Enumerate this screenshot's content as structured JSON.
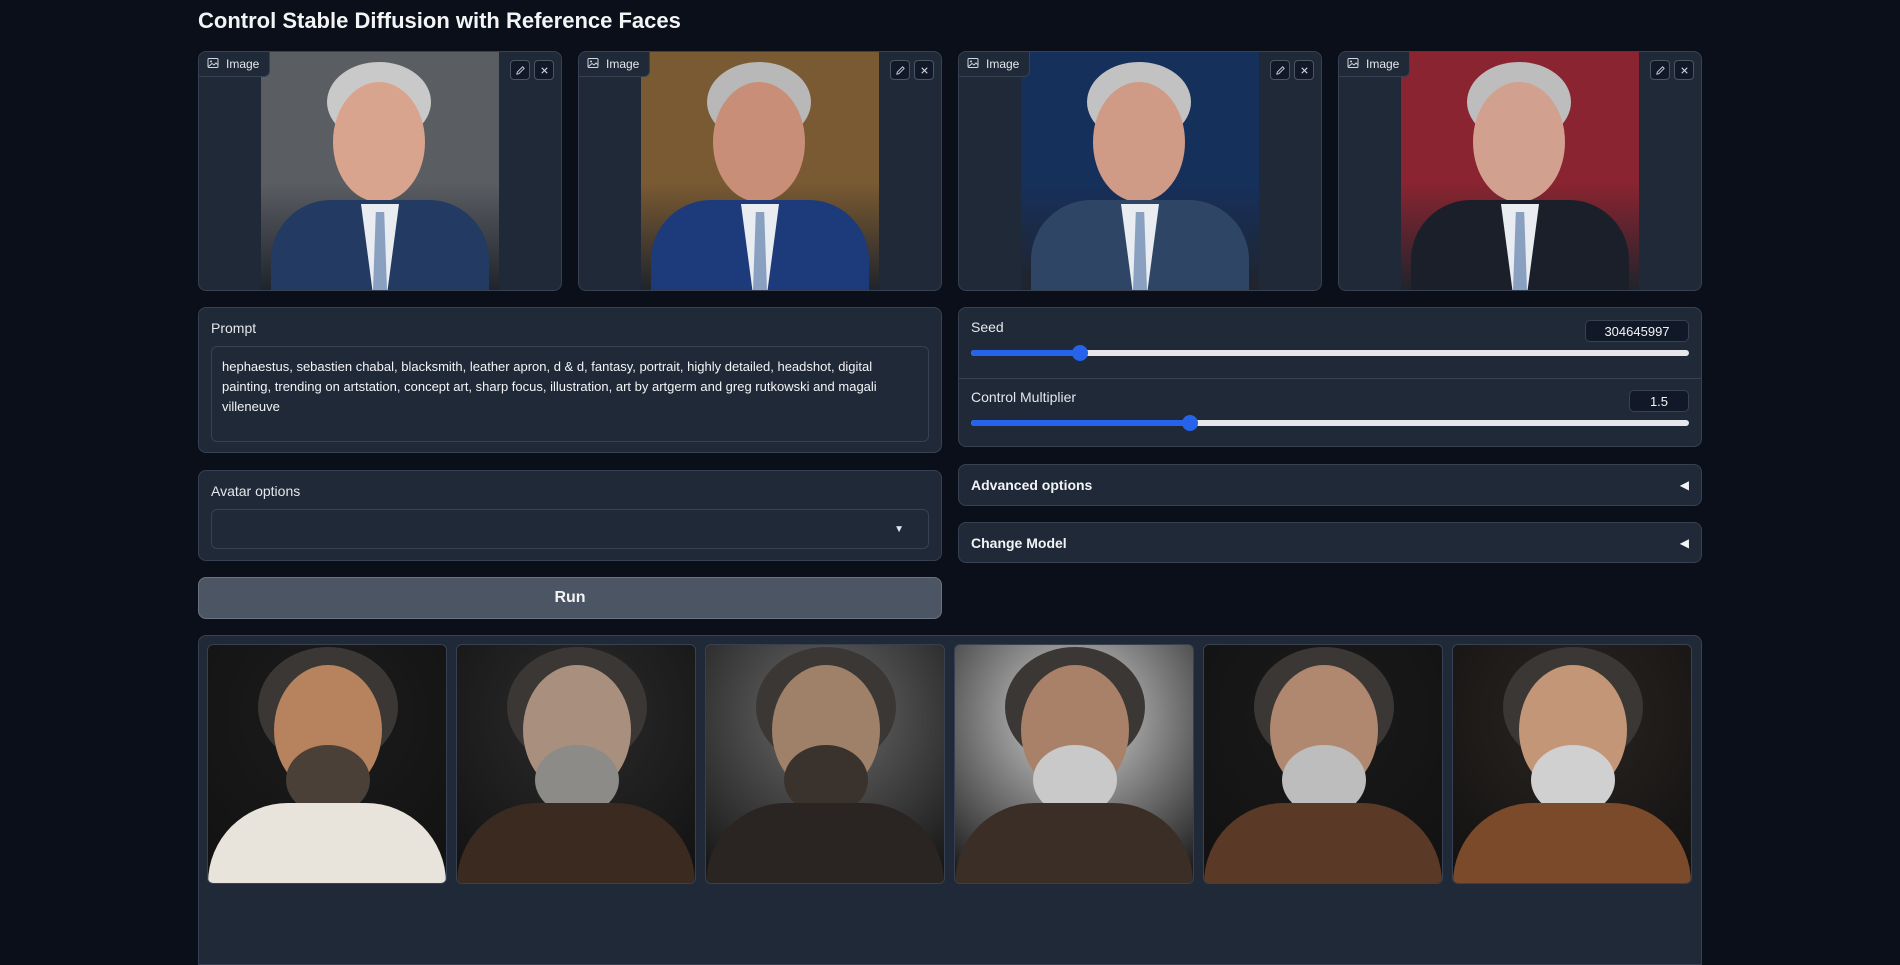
{
  "page": {
    "title": "Control Stable Diffusion with Reference Faces"
  },
  "reference_images": [
    {
      "label": "Image",
      "icon": "image-icon",
      "bg": "#5a5e63",
      "suit": "#233a63",
      "skin": "#d9a48e",
      "hair": "#c9c9c9"
    },
    {
      "label": "Image",
      "icon": "image-icon",
      "bg": "#7a5a32",
      "suit": "#1d3b7a",
      "skin": "#c98e78",
      "hair": "#b8b8b8"
    },
    {
      "label": "Image",
      "icon": "image-icon",
      "bg": "#16305c",
      "suit": "#2f4566",
      "skin": "#cf9a86",
      "hair": "#c2c2c2"
    },
    {
      "label": "Image",
      "icon": "image-icon",
      "bg": "#8a2430",
      "suit": "#1b1f2a",
      "skin": "#d2a08e",
      "hair": "#bdbdbd"
    }
  ],
  "prompt": {
    "label": "Prompt",
    "value": "hephaestus, sebastien chabal, blacksmith, leather apron, d & d, fantasy, portrait, highly detailed, headshot, digital painting, trending on artstation, concept art, sharp focus, illustration, art by artgerm and greg rutkowski and magali villeneuve"
  },
  "seed": {
    "label": "Seed",
    "value": "304645997",
    "fraction": 0.152
  },
  "control_multiplier": {
    "label": "Control Multiplier",
    "value": "1.5",
    "fraction": 0.305
  },
  "avatar_options": {
    "label": "Avatar options",
    "value": ""
  },
  "advanced_options": {
    "label": "Advanced options"
  },
  "change_model": {
    "label": "Change Model"
  },
  "run_button": {
    "label": "Run"
  },
  "gallery": [
    {
      "bg": "#1c1c1c",
      "skin": "#b7825e",
      "beard": "#4a4038",
      "cloth": "#e8e4dc"
    },
    {
      "bg": "#2b2b2b",
      "skin": "#a9907e",
      "beard": "#8d8b88",
      "cloth": "#3a2a20"
    },
    {
      "bg": "#6c6c6c",
      "skin": "#9f8069",
      "beard": "#3a332d",
      "cloth": "#2a2522"
    },
    {
      "bg": "#d8d8d8",
      "skin": "#a98168",
      "beard": "#c9c9c9",
      "cloth": "#3a2e26"
    },
    {
      "bg": "#1a1a1a",
      "skin": "#b08870",
      "beard": "#bdbdbd",
      "cloth": "#5a3a26"
    },
    {
      "bg": "#2a2420",
      "skin": "#c49678",
      "beard": "#d0d0d0",
      "cloth": "#7a4a2a"
    }
  ]
}
